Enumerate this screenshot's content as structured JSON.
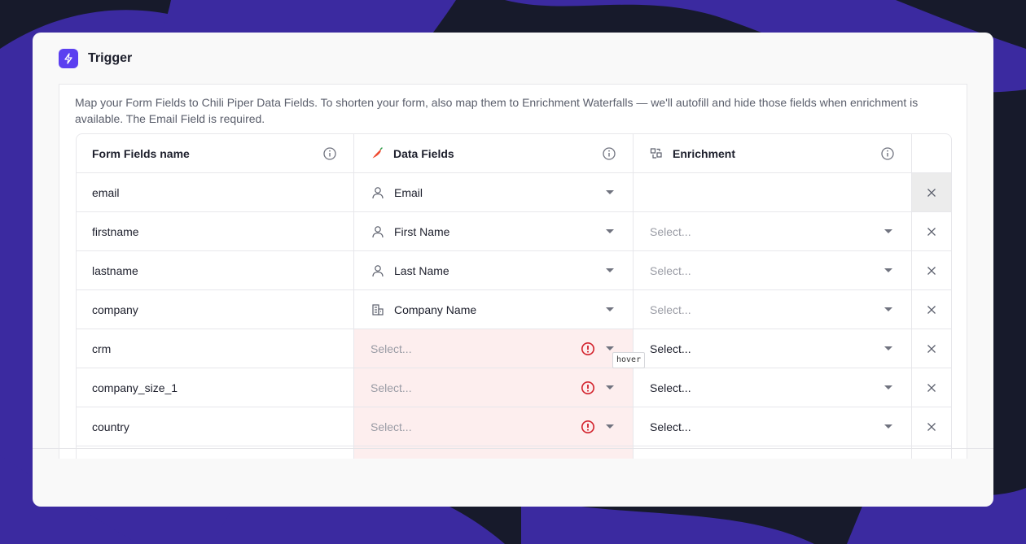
{
  "card": {
    "title": "Trigger",
    "description": "Map your Form Fields to Chili Piper Data Fields. To shorten your form, also map them to Enrichment Waterfalls — we'll autofill and hide those fields when enrichment is available. The Email Field is required."
  },
  "table": {
    "columns": [
      {
        "label": "Form Fields name",
        "icon": "none",
        "info_icon": "info-icon"
      },
      {
        "label": "Data Fields",
        "icon": "chili-pepper-icon",
        "info_icon": "info-icon"
      },
      {
        "label": "Enrichment",
        "icon": "enrichment-icon",
        "info_icon": "info-icon"
      }
    ],
    "rows": [
      {
        "form_field": "email",
        "data_field": "Email",
        "data_icon": "person-icon",
        "enrichment": ""
      },
      {
        "form_field": "firstname",
        "data_field": "First Name",
        "data_icon": "person-icon",
        "enrichment": "Select..."
      },
      {
        "form_field": "lastname",
        "data_field": "Last Name",
        "data_icon": "person-icon",
        "enrichment": "Select..."
      },
      {
        "form_field": "company",
        "data_field": "Company Name",
        "data_icon": "building-icon",
        "enrichment": "Select..."
      },
      {
        "form_field": "crm",
        "data_field": "Select...",
        "data_icon": "none",
        "enrichment": "Select...",
        "error": true
      },
      {
        "form_field": "company_size_1",
        "data_field": "Select...",
        "data_icon": "none",
        "enrichment": "Select...",
        "error": true
      },
      {
        "form_field": "country",
        "data_field": "Select...",
        "data_icon": "none",
        "enrichment": "Select...",
        "error": true
      }
    ]
  },
  "tooltip": "hover",
  "colors": {
    "accent": "#5b3ff0",
    "background_dark": "#171a2b",
    "background_purple": "#3b2aa0",
    "error": "#d2202a",
    "error_bg": "#fdeeee"
  }
}
